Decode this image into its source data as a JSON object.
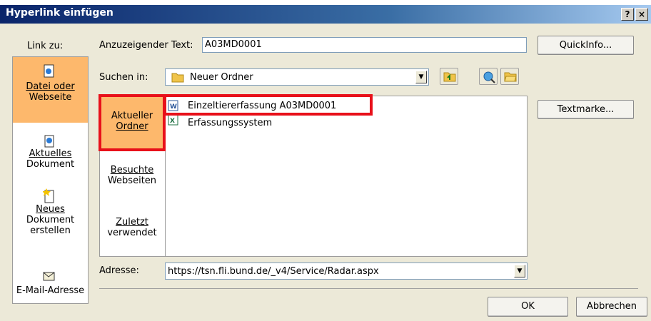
{
  "window": {
    "title": "Hyperlink einfügen",
    "help_label": "?",
    "close_label": "×"
  },
  "link_to": {
    "label": "Link zu:",
    "items": [
      {
        "label1": "Datei oder",
        "label2": "Webseite",
        "icon": "web-page-icon"
      },
      {
        "label1": "Aktuelles",
        "label2": "Dokument",
        "icon": "current-document-icon"
      },
      {
        "label1": "Neues",
        "label2": "Dokument",
        "label3": "erstellen",
        "icon": "new-document-icon"
      },
      {
        "label1": "E-Mail-Adresse",
        "icon": "email-icon"
      }
    ]
  },
  "display_text": {
    "label": "Anzuzeigender Text:",
    "value": "A03MD0001"
  },
  "quickinfo_label": "QuickInfo...",
  "search_in": {
    "label": "Suchen in:",
    "value": "Neuer Ordner"
  },
  "subnav": [
    {
      "label1": "Aktueller",
      "label2": "Ordner"
    },
    {
      "label1": "Besuchte",
      "label2": "Webseiten"
    },
    {
      "label1": "Zuletzt",
      "label2": "verwendet"
    }
  ],
  "files": [
    {
      "name": "Einzeltiererfassung A03MD0001",
      "icon": "word-document-icon"
    },
    {
      "name": "Erfassungssystem",
      "icon": "excel-workbook-icon"
    }
  ],
  "bookmark_label": "Textmarke...",
  "address": {
    "label": "Adresse:",
    "value": "https://tsn.fli.bund.de/_v4/Service/Radar.aspx"
  },
  "ok_label": "OK",
  "cancel_label": "Abbrechen",
  "colors": {
    "highlight": "#fdb86c",
    "annotation": "#e8101a",
    "title_bar": "#0a246a"
  }
}
